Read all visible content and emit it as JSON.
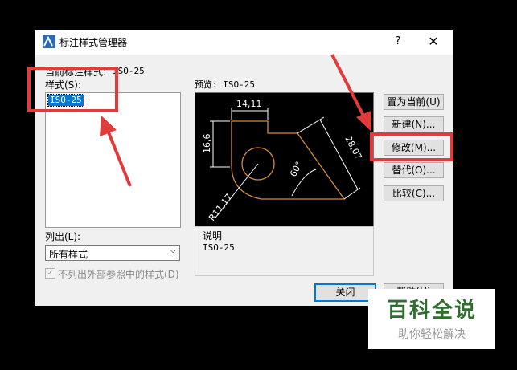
{
  "dialog": {
    "title": "标注样式管理器",
    "help_glyph": "?",
    "close_glyph": "✕",
    "current_style_label": "当前标注样式:",
    "current_style_value": "ISO-25",
    "styles_label": "样式(S):",
    "styles": [
      "ISO-25"
    ],
    "preview_label": "预览: ISO-25",
    "list_label": "列出(L):",
    "list_selected": "所有样式",
    "exclude_xref_label": "不列出外部参照中的样式(D)",
    "exclude_xref_checked": true,
    "check_glyph": "✓",
    "chevron": "⌵",
    "description_label": "说明",
    "description_value": "ISO-25",
    "buttons": {
      "set_current": "置为当前(U)",
      "new": "新建(N)...",
      "modify": "修改(M)...",
      "override": "替代(O)...",
      "compare": "比较(C)..."
    },
    "close_button": "关闭",
    "help_button": "帮助(H)"
  },
  "preview_dims": {
    "top": "14,11",
    "left": "16,6",
    "diagonal": "28,07",
    "angle": "60°",
    "radius": "R11,17"
  },
  "colors": {
    "highlight": "#e23b3b",
    "preview_lines": "#d28b3c",
    "dims": "#ffffff"
  },
  "watermark": {
    "title": "百科全说",
    "subtitle": "助你轻松解决"
  }
}
